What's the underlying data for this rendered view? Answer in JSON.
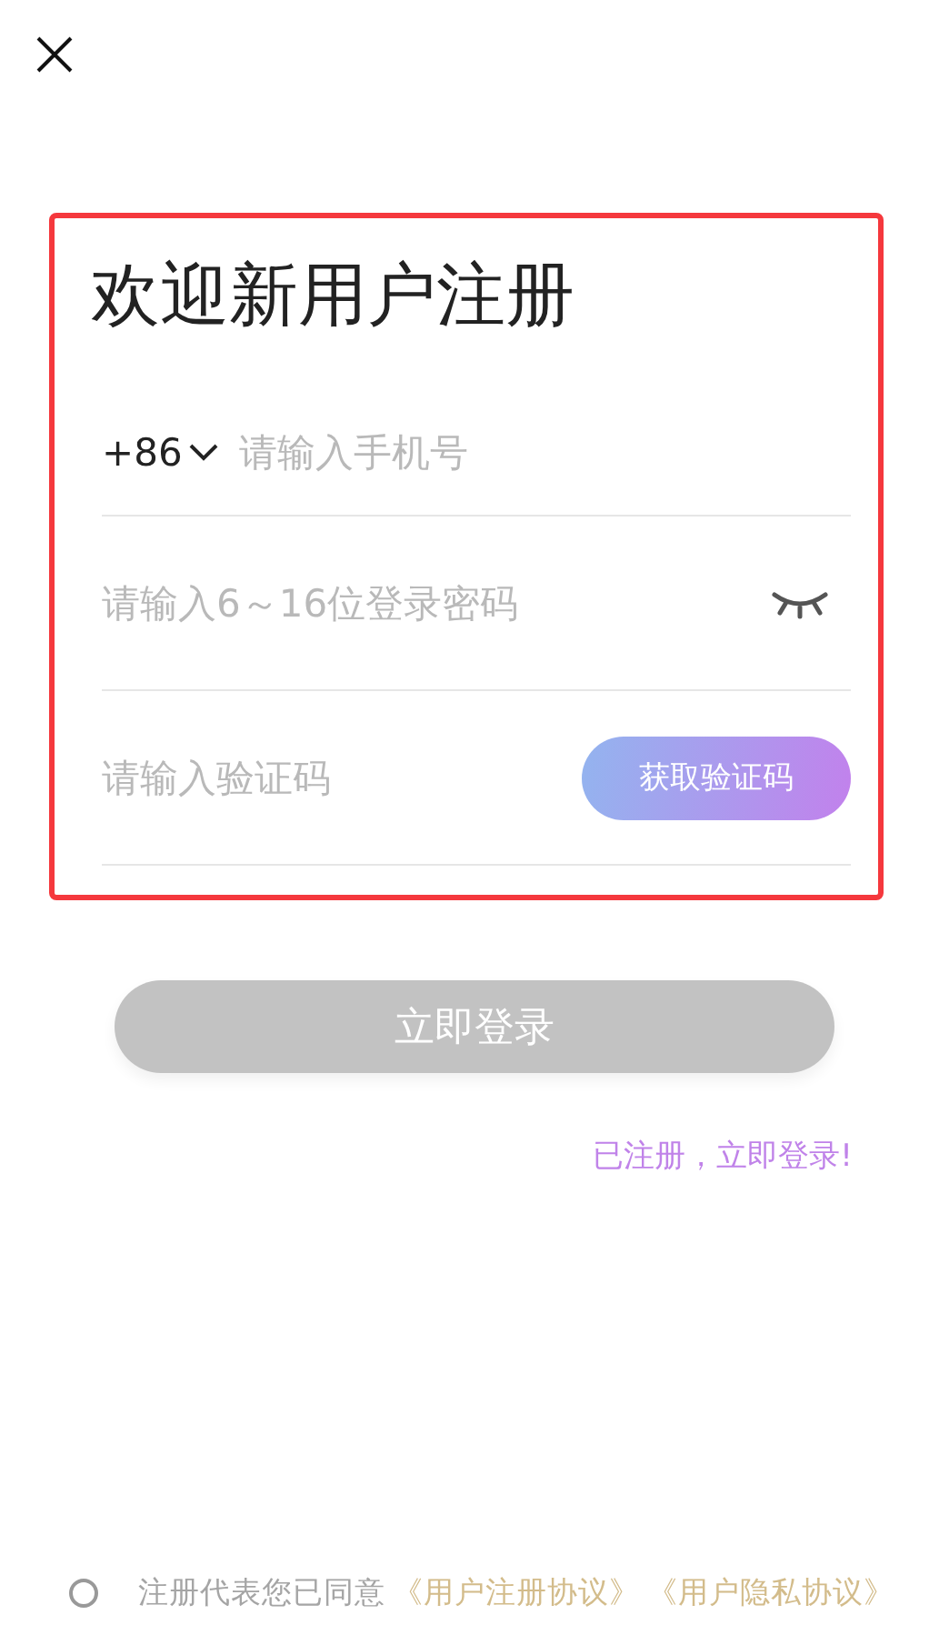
{
  "title": "欢迎新用户注册",
  "phone_field": {
    "country_code": "+86",
    "placeholder": "请输入手机号"
  },
  "password_field": {
    "placeholder": "请输入6～16位登录密码",
    "password_visible": false
  },
  "code_field": {
    "placeholder": "请输入验证码",
    "button": "获取验证码"
  },
  "login_button": {
    "label": "立即登录",
    "disabled": true
  },
  "login_link": "已注册，立即登录!",
  "agreement": {
    "checked": false,
    "text": "注册代表您已同意",
    "links": [
      "《用户注册协议》",
      "《用户隐私协议》"
    ]
  }
}
